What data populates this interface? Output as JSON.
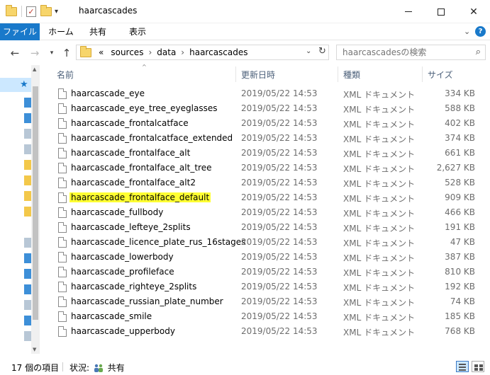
{
  "window": {
    "title": "haarcascades"
  },
  "ribbon": {
    "tabs": [
      "ファイル",
      "ホーム",
      "共有",
      "表示"
    ]
  },
  "address": {
    "prefix": "«",
    "crumbs": [
      "sources",
      "data",
      "haarcascades"
    ]
  },
  "search": {
    "placeholder": "haarcascadesの検索"
  },
  "columns": {
    "name": "名前",
    "date": "更新日時",
    "type": "種類",
    "size": "サイズ"
  },
  "files": [
    {
      "name": "haarcascade_eye",
      "date": "2019/05/22 14:53",
      "type": "XML ドキュメント",
      "size": "334 KB"
    },
    {
      "name": "haarcascade_eye_tree_eyeglasses",
      "date": "2019/05/22 14:53",
      "type": "XML ドキュメント",
      "size": "588 KB"
    },
    {
      "name": "haarcascade_frontalcatface",
      "date": "2019/05/22 14:53",
      "type": "XML ドキュメント",
      "size": "402 KB"
    },
    {
      "name": "haarcascade_frontalcatface_extended",
      "date": "2019/05/22 14:53",
      "type": "XML ドキュメント",
      "size": "374 KB"
    },
    {
      "name": "haarcascade_frontalface_alt",
      "date": "2019/05/22 14:53",
      "type": "XML ドキュメント",
      "size": "661 KB"
    },
    {
      "name": "haarcascade_frontalface_alt_tree",
      "date": "2019/05/22 14:53",
      "type": "XML ドキュメント",
      "size": "2,627 KB"
    },
    {
      "name": "haarcascade_frontalface_alt2",
      "date": "2019/05/22 14:53",
      "type": "XML ドキュメント",
      "size": "528 KB"
    },
    {
      "name": "haarcascade_frontalface_default",
      "date": "2019/05/22 14:53",
      "type": "XML ドキュメント",
      "size": "909 KB",
      "highlight": true
    },
    {
      "name": "haarcascade_fullbody",
      "date": "2019/05/22 14:53",
      "type": "XML ドキュメント",
      "size": "466 KB"
    },
    {
      "name": "haarcascade_lefteye_2splits",
      "date": "2019/05/22 14:53",
      "type": "XML ドキュメント",
      "size": "191 KB"
    },
    {
      "name": "haarcascade_licence_plate_rus_16stages",
      "date": "2019/05/22 14:53",
      "type": "XML ドキュメント",
      "size": "47 KB"
    },
    {
      "name": "haarcascade_lowerbody",
      "date": "2019/05/22 14:53",
      "type": "XML ドキュメント",
      "size": "387 KB"
    },
    {
      "name": "haarcascade_profileface",
      "date": "2019/05/22 14:53",
      "type": "XML ドキュメント",
      "size": "810 KB"
    },
    {
      "name": "haarcascade_righteye_2splits",
      "date": "2019/05/22 14:53",
      "type": "XML ドキュメント",
      "size": "192 KB"
    },
    {
      "name": "haarcascade_russian_plate_number",
      "date": "2019/05/22 14:53",
      "type": "XML ドキュメント",
      "size": "74 KB"
    },
    {
      "name": "haarcascade_smile",
      "date": "2019/05/22 14:53",
      "type": "XML ドキュメント",
      "size": "185 KB"
    },
    {
      "name": "haarcascade_upperbody",
      "date": "2019/05/22 14:53",
      "type": "XML ドキュメント",
      "size": "768 KB"
    }
  ],
  "status": {
    "count": "17 個の項目",
    "state_label": "状況:",
    "state_value": "共有"
  },
  "colors": {
    "accent": "#1979ca",
    "highlight": "#ffff33",
    "selection": "#cce8ff"
  }
}
